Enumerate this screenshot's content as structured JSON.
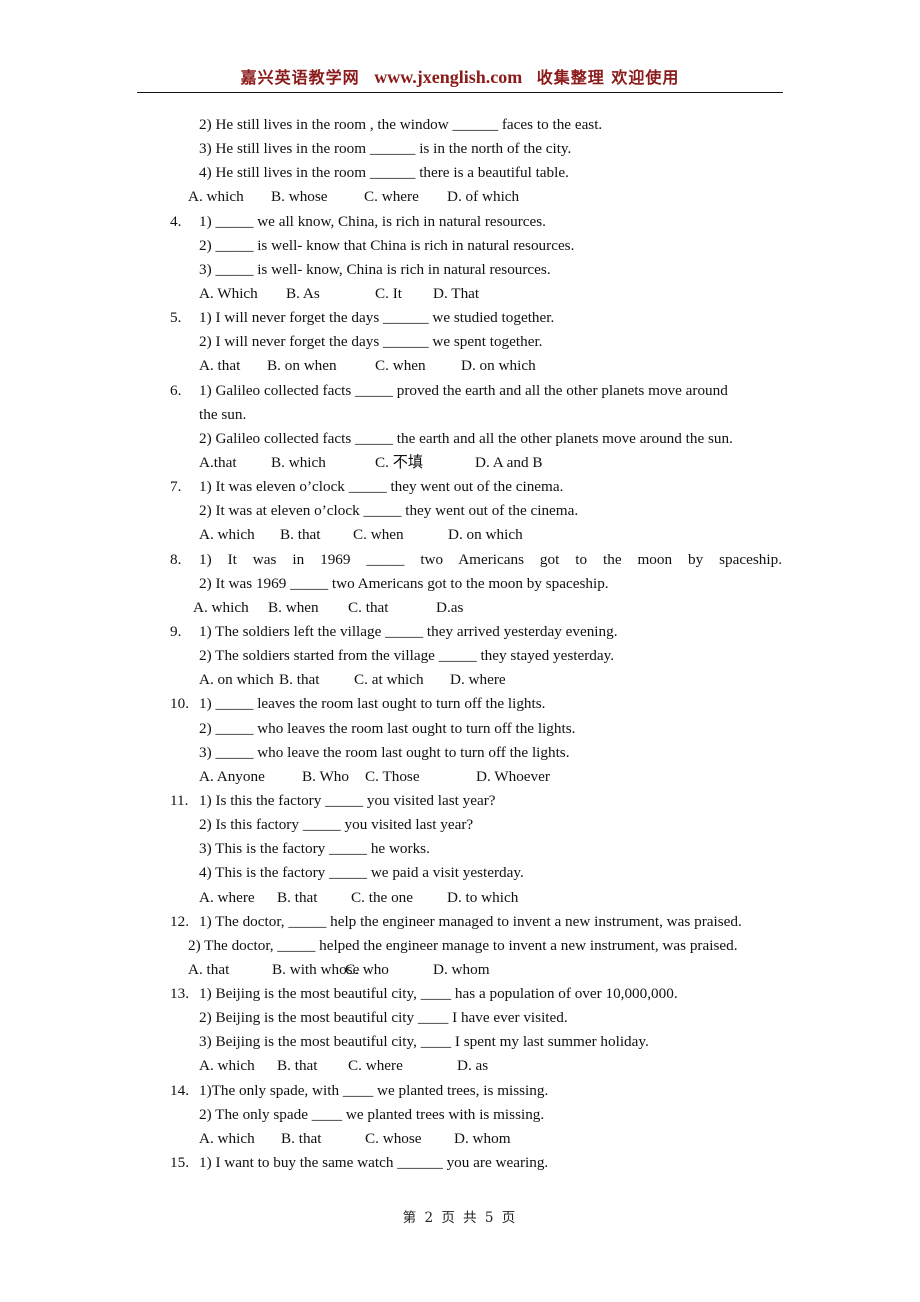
{
  "header": {
    "site_name": "嘉兴英语教学网",
    "url": "www.jxenglish.com",
    "slogan": "收集整理  欢迎使用"
  },
  "questions": [
    {
      "number": "",
      "items": [
        "2) He still lives in the room , the window ______ faces to the east.",
        "3) He still lives in the room ______ is in the north of the city.",
        "4) He still lives in the room ______ there is a beautiful table."
      ],
      "options": [
        "A. which",
        "B. whose",
        "C. where",
        "D. of which"
      ]
    },
    {
      "number": "4.",
      "items": [
        "1) _____ we all know, China, is rich in natural resources.",
        "2) _____ is well- know that China is rich in natural resources.",
        "3) _____ is well- know, China is rich in natural resources."
      ],
      "options": [
        "A. Which",
        "B. As",
        "C. It",
        "D. That"
      ]
    },
    {
      "number": "5.",
      "items": [
        "1) I will never forget the days ______ we studied together.",
        "2) I will never forget the days ______ we spent together."
      ],
      "options": [
        "A. that",
        "B. on when",
        "C. when",
        "D. on which"
      ]
    },
    {
      "number": "6.",
      "items": [
        "1) Galileo collected facts _____ proved the earth and all the other planets move around",
        "the sun.",
        "2) Galileo collected facts _____ the earth and all the other planets move around the sun."
      ],
      "options": [
        "A.that",
        "B. which",
        "C.  不填",
        "D. A and B"
      ]
    },
    {
      "number": "7.",
      "items": [
        "1) It was eleven o’clock _____ they went out of the cinema.",
        "2) It was at eleven o’clock _____ they went out of the cinema."
      ],
      "options": [
        "A. which",
        "B. that",
        "C. when",
        "D. on which"
      ]
    },
    {
      "number": "8.",
      "items": [
        "1) It was in 1969 _____ two Americans got to the moon by spaceship.",
        "2) It was 1969 _____ two Americans got to the moon by spaceship."
      ],
      "options": [
        "A. which",
        "B. when",
        "C. that",
        "D.as"
      ]
    },
    {
      "number": "9.",
      "items": [
        "1) The soldiers left the village _____ they arrived yesterday evening.",
        "2) The soldiers started from the village _____ they stayed yesterday."
      ],
      "options": [
        "A. on which",
        "B. that",
        "C. at which",
        "D. where"
      ]
    },
    {
      "number": "10.",
      "items": [
        "1) _____ leaves the room last ought to turn off the lights.",
        "2) _____ who leaves the room last ought to turn off the lights.",
        "3) _____ who leave the room last ought to turn off the lights."
      ],
      "options": [
        "A. Anyone",
        "B. Who",
        "C. Those",
        "D. Whoever"
      ]
    },
    {
      "number": "11.",
      "items": [
        "1) Is this the factory _____ you visited last year?",
        "2) Is this factory _____ you visited last year?",
        "3) This is the factory _____ he works.",
        "4) This is the factory _____ we paid a visit yesterday."
      ],
      "options": [
        "A. where",
        "B. that",
        "C. the one",
        "D. to which"
      ]
    },
    {
      "number": "12.",
      "items": [
        "1) The doctor, _____ help the engineer managed to invent a new instrument, was praised.",
        "2) The doctor, _____ helped the engineer manage to invent a new instrument, was praised."
      ],
      "options": [
        "A. that",
        "B. with whose",
        "C. who",
        "D. whom"
      ]
    },
    {
      "number": "13.",
      "items": [
        "1) Beijing is the most beautiful city, ____ has a population of over 10,000,000.",
        "2) Beijing is the most beautiful city ____ I have ever visited.",
        "3) Beijing is the most beautiful city, ____ I spent my last summer holiday."
      ],
      "options": [
        "A. which",
        "B. that",
        "C. where",
        "D. as"
      ]
    },
    {
      "number": "14.",
      "items": [
        "1)The only spade, with ____ we planted trees, is missing.",
        "2) The only spade ____ we planted trees with is missing."
      ],
      "options": [
        "A. which",
        "B. that",
        "C. whose",
        "D. whom"
      ]
    },
    {
      "number": "15.",
      "items": [
        "1) I want to buy the same watch ______ you are wearing."
      ],
      "options": []
    }
  ],
  "footer": {
    "page_label": "第 2 页 共 5 页"
  },
  "colors": {
    "header_text": "#8b1a1a",
    "body_text": "#111111"
  }
}
